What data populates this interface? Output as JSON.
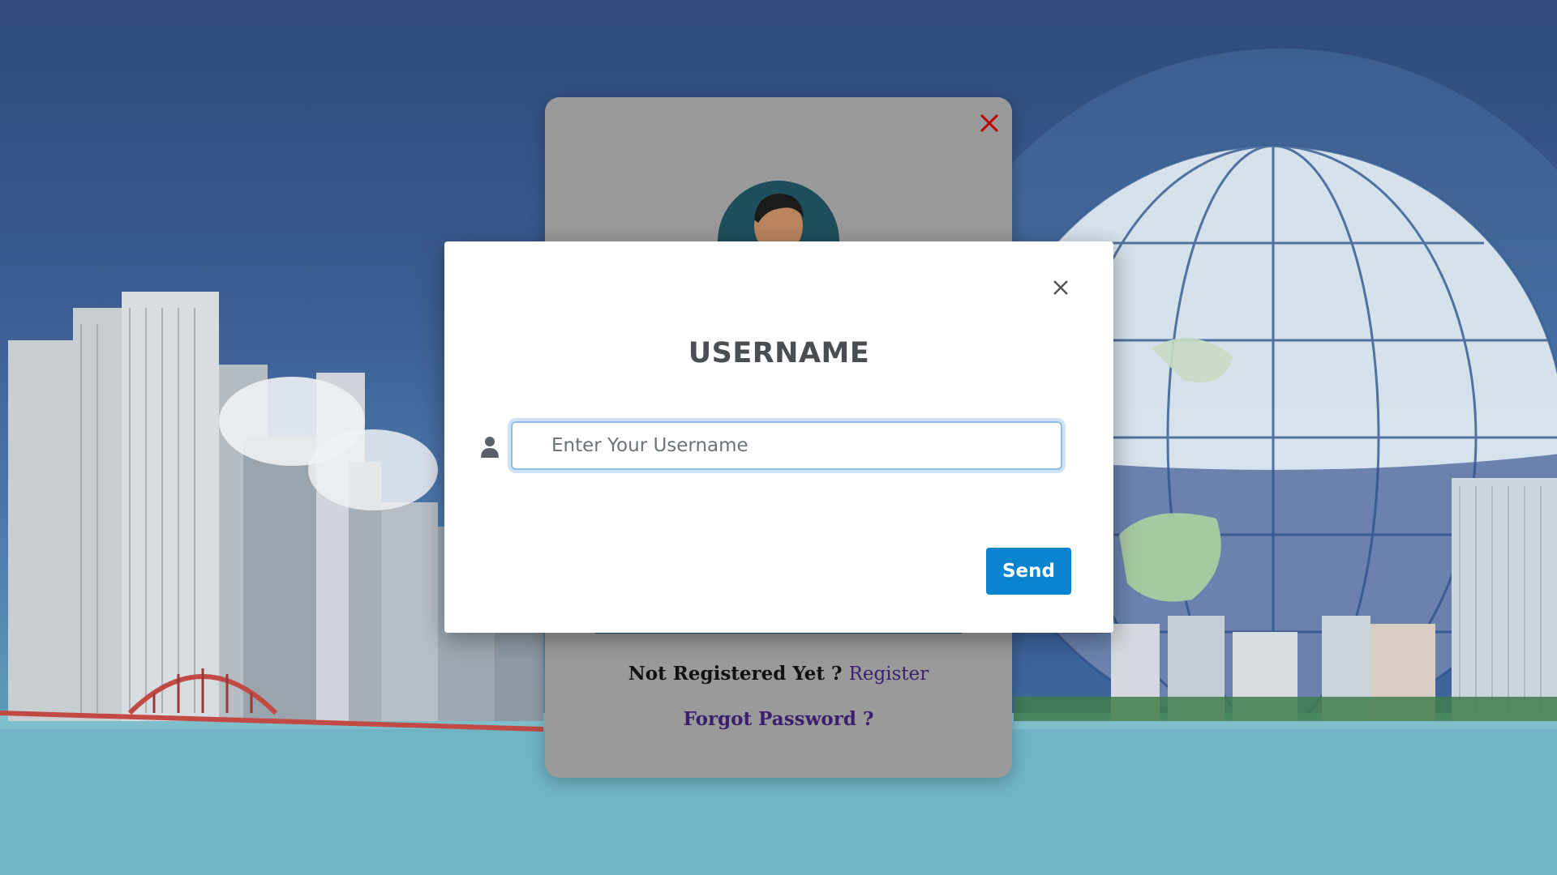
{
  "modal": {
    "title": "USERNAME",
    "input_placeholder": "Enter Your Username",
    "input_value": "",
    "send_label": "Send"
  },
  "login_card": {
    "not_registered_text": "Not Registered Yet ?",
    "register_label": "Register",
    "forgot_password_label": "Forgot Password ?"
  },
  "icons": {
    "modal_close": "close-icon",
    "login_close": "close-icon",
    "user": "user-icon",
    "avatar": "avatar"
  },
  "colors": {
    "send_button": "#0a84d0",
    "login_close": "#c00000",
    "link": "#3a1f6b",
    "card_dimmed": "#9a9a9a"
  }
}
